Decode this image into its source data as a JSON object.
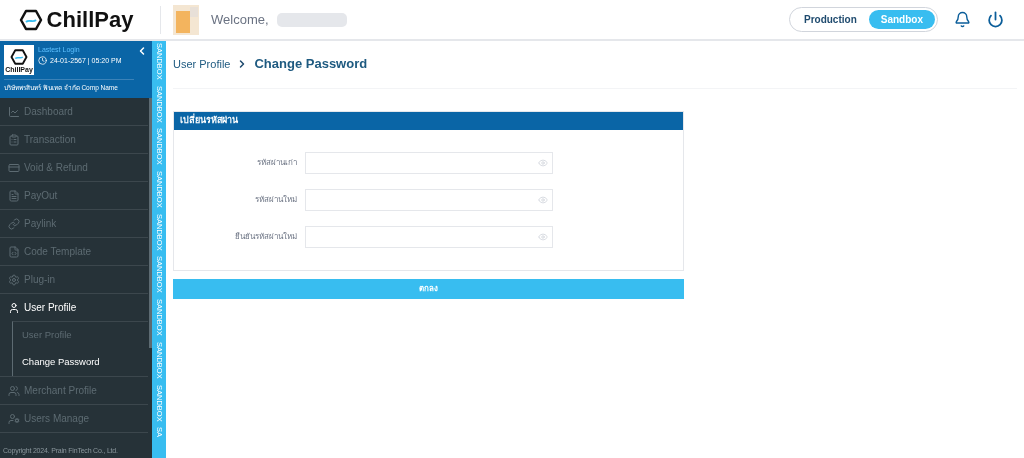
{
  "header": {
    "logo": "ChillPay",
    "welcome": "Welcome,",
    "environment": [
      {
        "label": "Production",
        "selected": false
      },
      {
        "label": "Sandbox",
        "selected": true
      }
    ]
  },
  "account": {
    "logo": "ChillPay",
    "login_label": "Lastest Login",
    "login_time": "24-01-2567 | 05:20 PM",
    "company": "บริษัทพรสินทร์ ฟินเทค จำกัด Comp Name"
  },
  "sidebar": {
    "items": [
      {
        "kind": "chart",
        "label": "Dashboard",
        "selected": false
      },
      {
        "kind": "clipboard",
        "label": "Transaction",
        "selected": false
      },
      {
        "kind": "card",
        "label": "Void & Refund",
        "selected": false
      },
      {
        "kind": "file",
        "label": "PayOut",
        "selected": false
      },
      {
        "kind": "link",
        "label": "Paylink",
        "selected": false
      },
      {
        "kind": "code",
        "label": "Code Template",
        "selected": false
      },
      {
        "kind": "gear",
        "label": "Plug-in",
        "selected": false
      },
      {
        "kind": "user",
        "label": "User Profile",
        "selected": true,
        "expanded": true,
        "children": [
          {
            "label": "User Profile",
            "selected": false
          },
          {
            "label": "Change Password",
            "selected": true
          }
        ]
      },
      {
        "kind": "users",
        "label": "Merchant Profile",
        "selected": false
      },
      {
        "kind": "usercog",
        "label": "Users Manage",
        "selected": false
      }
    ],
    "copyright": "Copyright 2024. Prain FinTech Co., Ltd."
  },
  "sandbox_strip": [
    "SANDBOX",
    "SANDBOX",
    "SANDBOX",
    "SANDBOX",
    "SANDBOX",
    "SANDBOX",
    "SANDBOX",
    "SANDBOX",
    "SANDBOX",
    "SA"
  ],
  "breadcrumb": {
    "parent": "User Profile",
    "current": "Change Password"
  },
  "form": {
    "title": "เปลี่ยนรหัสผ่าน",
    "fields": [
      {
        "label": "รหัสผ่านเก่า"
      },
      {
        "label": "รหัสผ่านใหม่"
      },
      {
        "label": "ยืนยันรหัสผ่านใหม่"
      }
    ],
    "submit": "ตกลง"
  }
}
